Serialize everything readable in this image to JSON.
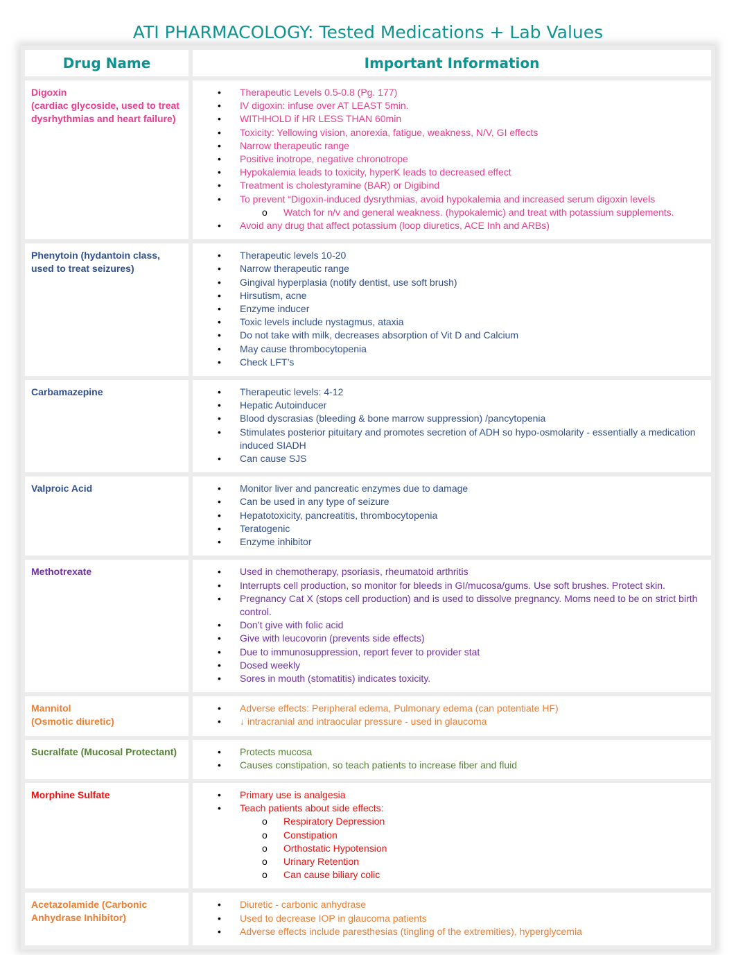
{
  "title": "ATI PHARMACOLOGY: Tested Medications + Lab Values",
  "headers": {
    "drug_name": "Drug Name",
    "important_info": "Important Information"
  },
  "colors": {
    "title": "#0e9393",
    "digoxin": "#ec3a8f",
    "blue": "#2f4f8f",
    "purple": "#7030a0",
    "orange": "#ed7d31",
    "green": "#548235",
    "red": "#ee1111"
  },
  "rows": [
    {
      "drug": [
        "Digoxin",
        "(cardiac glycoside, used to treat dysrhythmias and heart failure)"
      ],
      "items": [
        {
          "text": "Therapeutic Levels 0.5-0.8 (Pg. 177)"
        },
        {
          "text": "IV digoxin: infuse over AT LEAST 5min."
        },
        {
          "text": "WITHHOLD if HR LESS THAN 60min"
        },
        {
          "text": "Toxicity: Yellowing vision, anorexia, fatigue, weakness, N/V, GI effects"
        },
        {
          "text": "Narrow therapeutic range"
        },
        {
          "text": "Positive inotrope, negative chronotrope"
        },
        {
          "text": "Hypokalemia leads to toxicity, hyperK leads to decreased effect"
        },
        {
          "text": "Treatment is cholestyramine (BAR) or Digibind"
        },
        {
          "text": "To prevent “Digoxin-induced dysrythmias, avoid hypokalemia and increased serum digoxin levels"
        },
        {
          "text": "Watch for n/v and general weakness. (hypokalemic) and treat with potassium supplements.",
          "sub": true
        },
        {
          "text": "Avoid any drug that affect potassium (loop diuretics, ACE Inh and ARBs)"
        }
      ]
    },
    {
      "drug": [
        "Phenytoin (hydantoin class, used to treat seizures)"
      ],
      "items": [
        {
          "text": "Therapeutic levels 10-20"
        },
        {
          "text": "Narrow therapeutic range"
        },
        {
          "text": "Gingival hyperplasia (notify dentist, use soft brush)"
        },
        {
          "text": "Hirsutism, acne"
        },
        {
          "text": "Enzyme inducer"
        },
        {
          "text": "Toxic levels include nystagmus, ataxia"
        },
        {
          "text": "Do not take with milk, decreases absorption of Vit D and Calcium"
        },
        {
          "text": "May cause thrombocytopenia"
        },
        {
          "text": "Check LFT’s"
        }
      ]
    },
    {
      "drug": [
        "Carbamazepine"
      ],
      "items": [
        {
          "text": "Therapeutic levels: 4-12"
        },
        {
          "text": "Hepatic Autoinducer"
        },
        {
          "text": "Blood dyscrasias (bleeding & bone marrow suppression) /pancytopenia"
        },
        {
          "text": "Stimulates posterior pituitary and promotes secretion of ADH so hypo-osmolarity - essentially a medication induced SIADH"
        },
        {
          "text": "Can cause SJS"
        }
      ]
    },
    {
      "drug": [
        "Valproic Acid"
      ],
      "items": [
        {
          "text": "Monitor liver and pancreatic enzymes due to damage"
        },
        {
          "text": "Can be used in any type of seizure"
        },
        {
          "text": "Hepatotoxicity, pancreatitis, thrombocytopenia"
        },
        {
          "text": "Teratogenic"
        },
        {
          "text": "Enzyme inhibitor"
        }
      ]
    },
    {
      "drug": [
        "Methotrexate"
      ],
      "items": [
        {
          "text": "Used in chemotherapy, psoriasis, rheumatoid arthritis"
        },
        {
          "text": "Interrupts cell production, so monitor for bleeds in GI/mucosa/gums. Use soft brushes. Protect skin."
        },
        {
          "text": "Pregnancy Cat X (stops cell production) and is used to dissolve pregnancy. Moms need to be on strict birth control."
        },
        {
          "text": "Don’t give with folic acid"
        },
        {
          "text": "Give with leucovorin (prevents side effects)"
        },
        {
          "text": "Due to immunosuppression, report fever to provider stat"
        },
        {
          "text": "Dosed weekly"
        },
        {
          "text": "Sores in mouth (stomatitis) indicates toxicity."
        }
      ]
    },
    {
      "drug": [
        "Mannitol",
        "(Osmotic diuretic)"
      ],
      "items": [
        {
          "text": "Adverse effects: Peripheral edema, Pulmonary edema (can potentiate HF)"
        },
        {
          "text": "↓ intracranial and intraocular pressure - used in glaucoma"
        }
      ]
    },
    {
      "drug": [
        "Sucralfate (Mucosal Protectant)"
      ],
      "items": [
        {
          "text": "Protects mucosa"
        },
        {
          "text": "Causes constipation, so teach patients to increase fiber and fluid"
        }
      ]
    },
    {
      "drug": [
        "Morphine Sulfate"
      ],
      "items": [
        {
          "text": "Primary use is analgesia"
        },
        {
          "text": "Teach patients about side effects:"
        },
        {
          "text": "Respiratory Depression",
          "sub": true
        },
        {
          "text": "Constipation",
          "sub": true
        },
        {
          "text": "Orthostatic Hypotension",
          "sub": true
        },
        {
          "text": "Urinary Retention",
          "sub": true
        },
        {
          "text": "Can cause biliary colic",
          "sub": true
        }
      ]
    },
    {
      "drug": [
        "Acetazolamide (Carbonic Anhydrase Inhibitor)"
      ],
      "items": [
        {
          "text": "Diuretic - carbonic anhydrase"
        },
        {
          "text": "Used to decrease IOP in glaucoma patients"
        },
        {
          "text": "Adverse effects include paresthesias (tingling of the extremities), hyperglycemia"
        }
      ]
    }
  ]
}
